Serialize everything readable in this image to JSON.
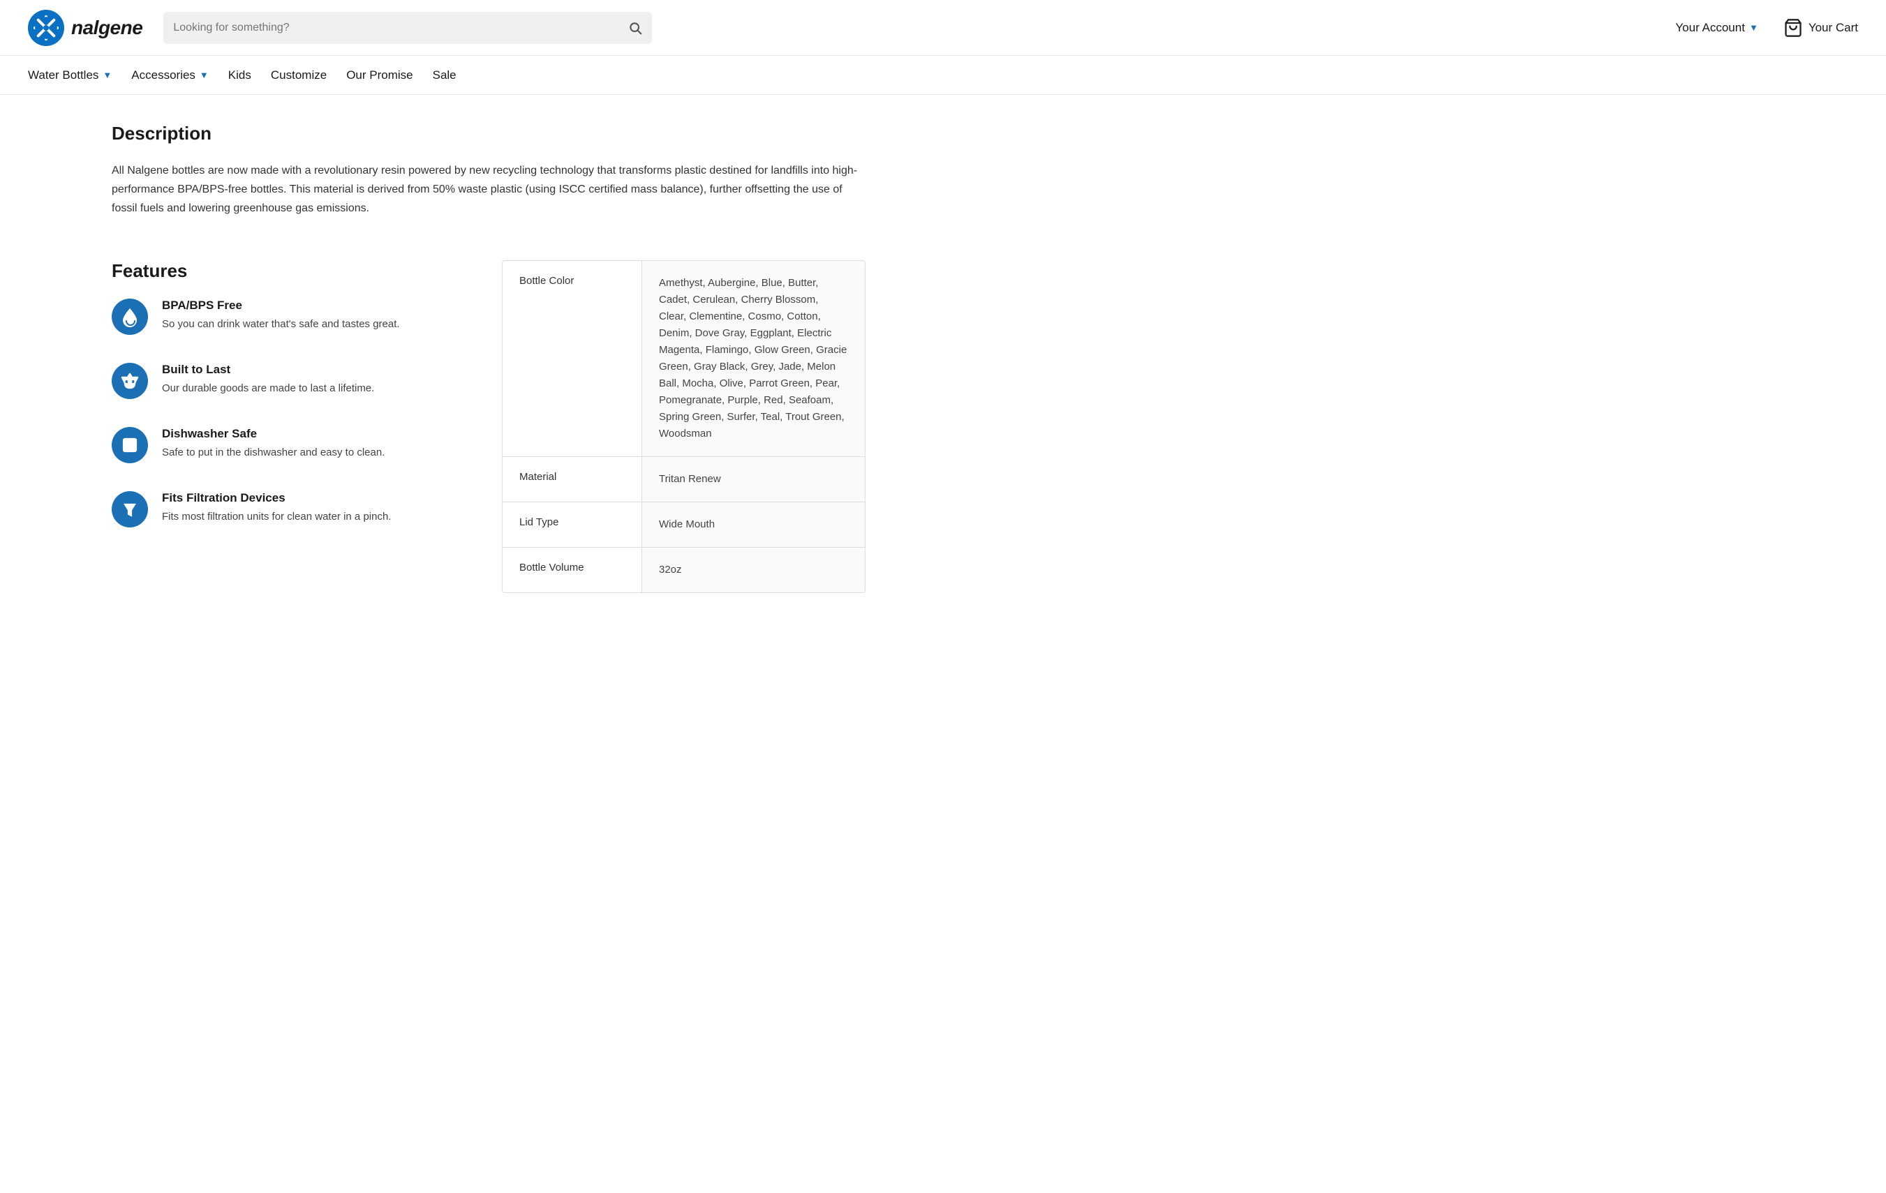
{
  "header": {
    "logo_text": "nalgene",
    "search_placeholder": "Looking for something?",
    "account_label": "Your Account",
    "cart_label": "Your Cart"
  },
  "nav": {
    "items": [
      {
        "label": "Water Bottles",
        "has_chevron": true
      },
      {
        "label": "Accessories",
        "has_chevron": true
      },
      {
        "label": "Kids",
        "has_chevron": false
      },
      {
        "label": "Customize",
        "has_chevron": false
      },
      {
        "label": "Our Promise",
        "has_chevron": false
      },
      {
        "label": "Sale",
        "has_chevron": false
      }
    ]
  },
  "description": {
    "title": "Description",
    "text": "All Nalgene bottles are now made with a revolutionary resin powered by new recycling technology that transforms plastic destined for landfills into high-performance BPA/BPS-free bottles. This material is derived from 50% waste plastic (using ISCC certified mass balance), further offsetting the use of fossil fuels and lowering greenhouse gas emissions."
  },
  "features": {
    "title": "Features",
    "items": [
      {
        "id": "bpa-bps-free",
        "title": "BPA/BPS Free",
        "desc": "So you can drink water that's safe and tastes great."
      },
      {
        "id": "built-to-last",
        "title": "Built to Last",
        "desc": "Our durable goods are made to last a lifetime."
      },
      {
        "id": "dishwasher-safe",
        "title": "Dishwasher Safe",
        "desc": "Safe to put in the dishwasher and easy to clean."
      },
      {
        "id": "filtration-devices",
        "title": "Fits Filtration Devices",
        "desc": "Fits most filtration units for clean water in a pinch."
      }
    ]
  },
  "specs": {
    "rows": [
      {
        "label": "Bottle Color",
        "value": "Amethyst, Aubergine, Blue, Butter, Cadet, Cerulean, Cherry Blossom, Clear, Clementine, Cosmo, Cotton, Denim, Dove Gray, Eggplant, Electric Magenta, Flamingo, Glow Green, Gracie Green, Gray Black, Grey, Jade, Melon Ball, Mocha, Olive, Parrot Green, Pear, Pomegranate, Purple, Red, Seafoam, Spring Green, Surfer, Teal, Trout Green, Woodsman"
      },
      {
        "label": "Material",
        "value": "Tritan Renew"
      },
      {
        "label": "Lid Type",
        "value": "Wide Mouth"
      },
      {
        "label": "Bottle Volume",
        "value": "32oz"
      }
    ]
  }
}
